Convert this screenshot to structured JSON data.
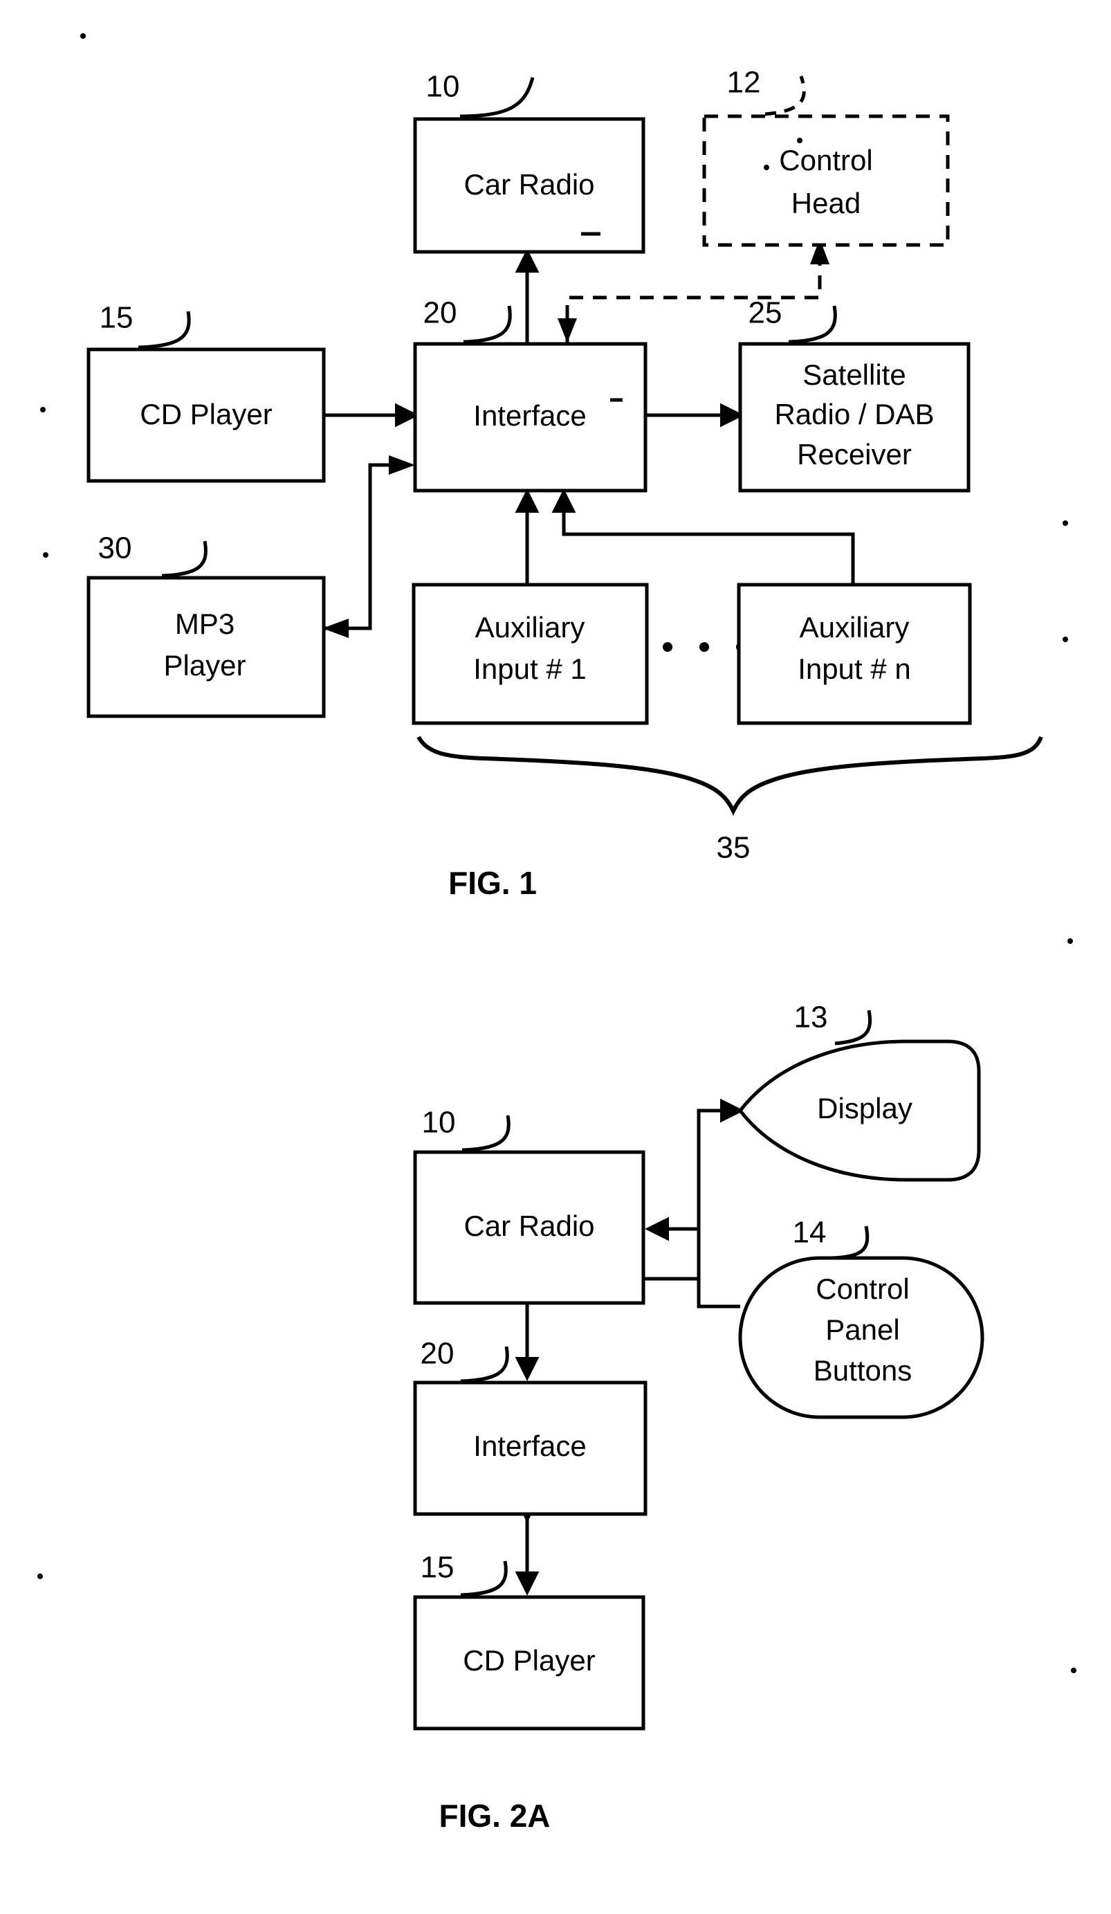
{
  "document": {
    "kind": "patent-drawing-sheet",
    "background_color": "#ffffff",
    "ink_color": "#000000"
  },
  "figures": [
    {
      "id": "fig1",
      "caption": "FIG. 1",
      "nodes": [
        {
          "id": "car-radio",
          "ref": "10",
          "lines": [
            "Car Radio"
          ],
          "shape": "rect",
          "style": "solid"
        },
        {
          "id": "control-head",
          "ref": "12",
          "lines": [
            "Control",
            "Head"
          ],
          "shape": "rect",
          "style": "dashed"
        },
        {
          "id": "cd-player",
          "ref": "15",
          "lines": [
            "CD Player"
          ],
          "shape": "rect",
          "style": "solid"
        },
        {
          "id": "interface",
          "ref": "20",
          "lines": [
            "Interface"
          ],
          "shape": "rect",
          "style": "solid"
        },
        {
          "id": "satellite-radio",
          "ref": "25",
          "lines": [
            "Satellite",
            "Radio / DAB",
            "Receiver"
          ],
          "shape": "rect",
          "style": "solid"
        },
        {
          "id": "mp3-player",
          "ref": "30",
          "lines": [
            "MP3",
            "Player"
          ],
          "shape": "rect",
          "style": "solid"
        },
        {
          "id": "aux-input-1",
          "ref": "",
          "lines": [
            "Auxiliary",
            "Input # 1"
          ],
          "shape": "rect",
          "style": "solid"
        },
        {
          "id": "aux-input-n",
          "ref": "",
          "lines": [
            "Auxiliary",
            "Input # n"
          ],
          "shape": "rect",
          "style": "solid"
        }
      ],
      "group_brace": {
        "ref": "35",
        "spans": [
          "aux-input-1",
          "aux-input-n"
        ]
      },
      "ellipsis": "...",
      "connections": [
        {
          "from": "interface",
          "to": "car-radio",
          "arrows": "both",
          "style": "solid"
        },
        {
          "from": "interface",
          "to": "control-head",
          "arrows": "both",
          "style": "dashed"
        },
        {
          "from": "cd-player",
          "to": "interface",
          "arrows": "both",
          "style": "solid"
        },
        {
          "from": "interface",
          "to": "satellite-radio",
          "arrows": "both",
          "style": "solid"
        },
        {
          "from": "mp3-player",
          "to": "interface",
          "arrows": "both",
          "style": "solid"
        },
        {
          "from": "aux-input-1",
          "to": "interface",
          "arrows": "to",
          "style": "solid"
        },
        {
          "from": "aux-input-n",
          "to": "interface",
          "arrows": "to",
          "style": "solid"
        }
      ]
    },
    {
      "id": "fig2a",
      "caption": "FIG. 2A",
      "nodes": [
        {
          "id": "car-radio-2a",
          "ref": "10",
          "lines": [
            "Car Radio"
          ],
          "shape": "rect",
          "style": "solid"
        },
        {
          "id": "display",
          "ref": "13",
          "lines": [
            "Display"
          ],
          "shape": "flag",
          "style": "solid"
        },
        {
          "id": "control-panel-buttons",
          "ref": "14",
          "lines": [
            "Control",
            "Panel",
            "Buttons"
          ],
          "shape": "stadium",
          "style": "solid"
        },
        {
          "id": "interface-2a",
          "ref": "20",
          "lines": [
            "Interface"
          ],
          "shape": "rect",
          "style": "solid"
        },
        {
          "id": "cd-player-2a",
          "ref": "15",
          "lines": [
            "CD Player"
          ],
          "shape": "rect",
          "style": "solid"
        }
      ],
      "connections": [
        {
          "from": "car-radio-2a",
          "to": "display",
          "arrows": "to",
          "style": "solid"
        },
        {
          "from": "control-panel-buttons",
          "to": "car-radio-2a",
          "arrows": "to",
          "style": "solid"
        },
        {
          "from": "car-radio-2a",
          "to": "interface-2a",
          "arrows": "both",
          "style": "solid"
        },
        {
          "from": "interface-2a",
          "to": "cd-player-2a",
          "arrows": "both",
          "style": "solid"
        }
      ]
    }
  ]
}
